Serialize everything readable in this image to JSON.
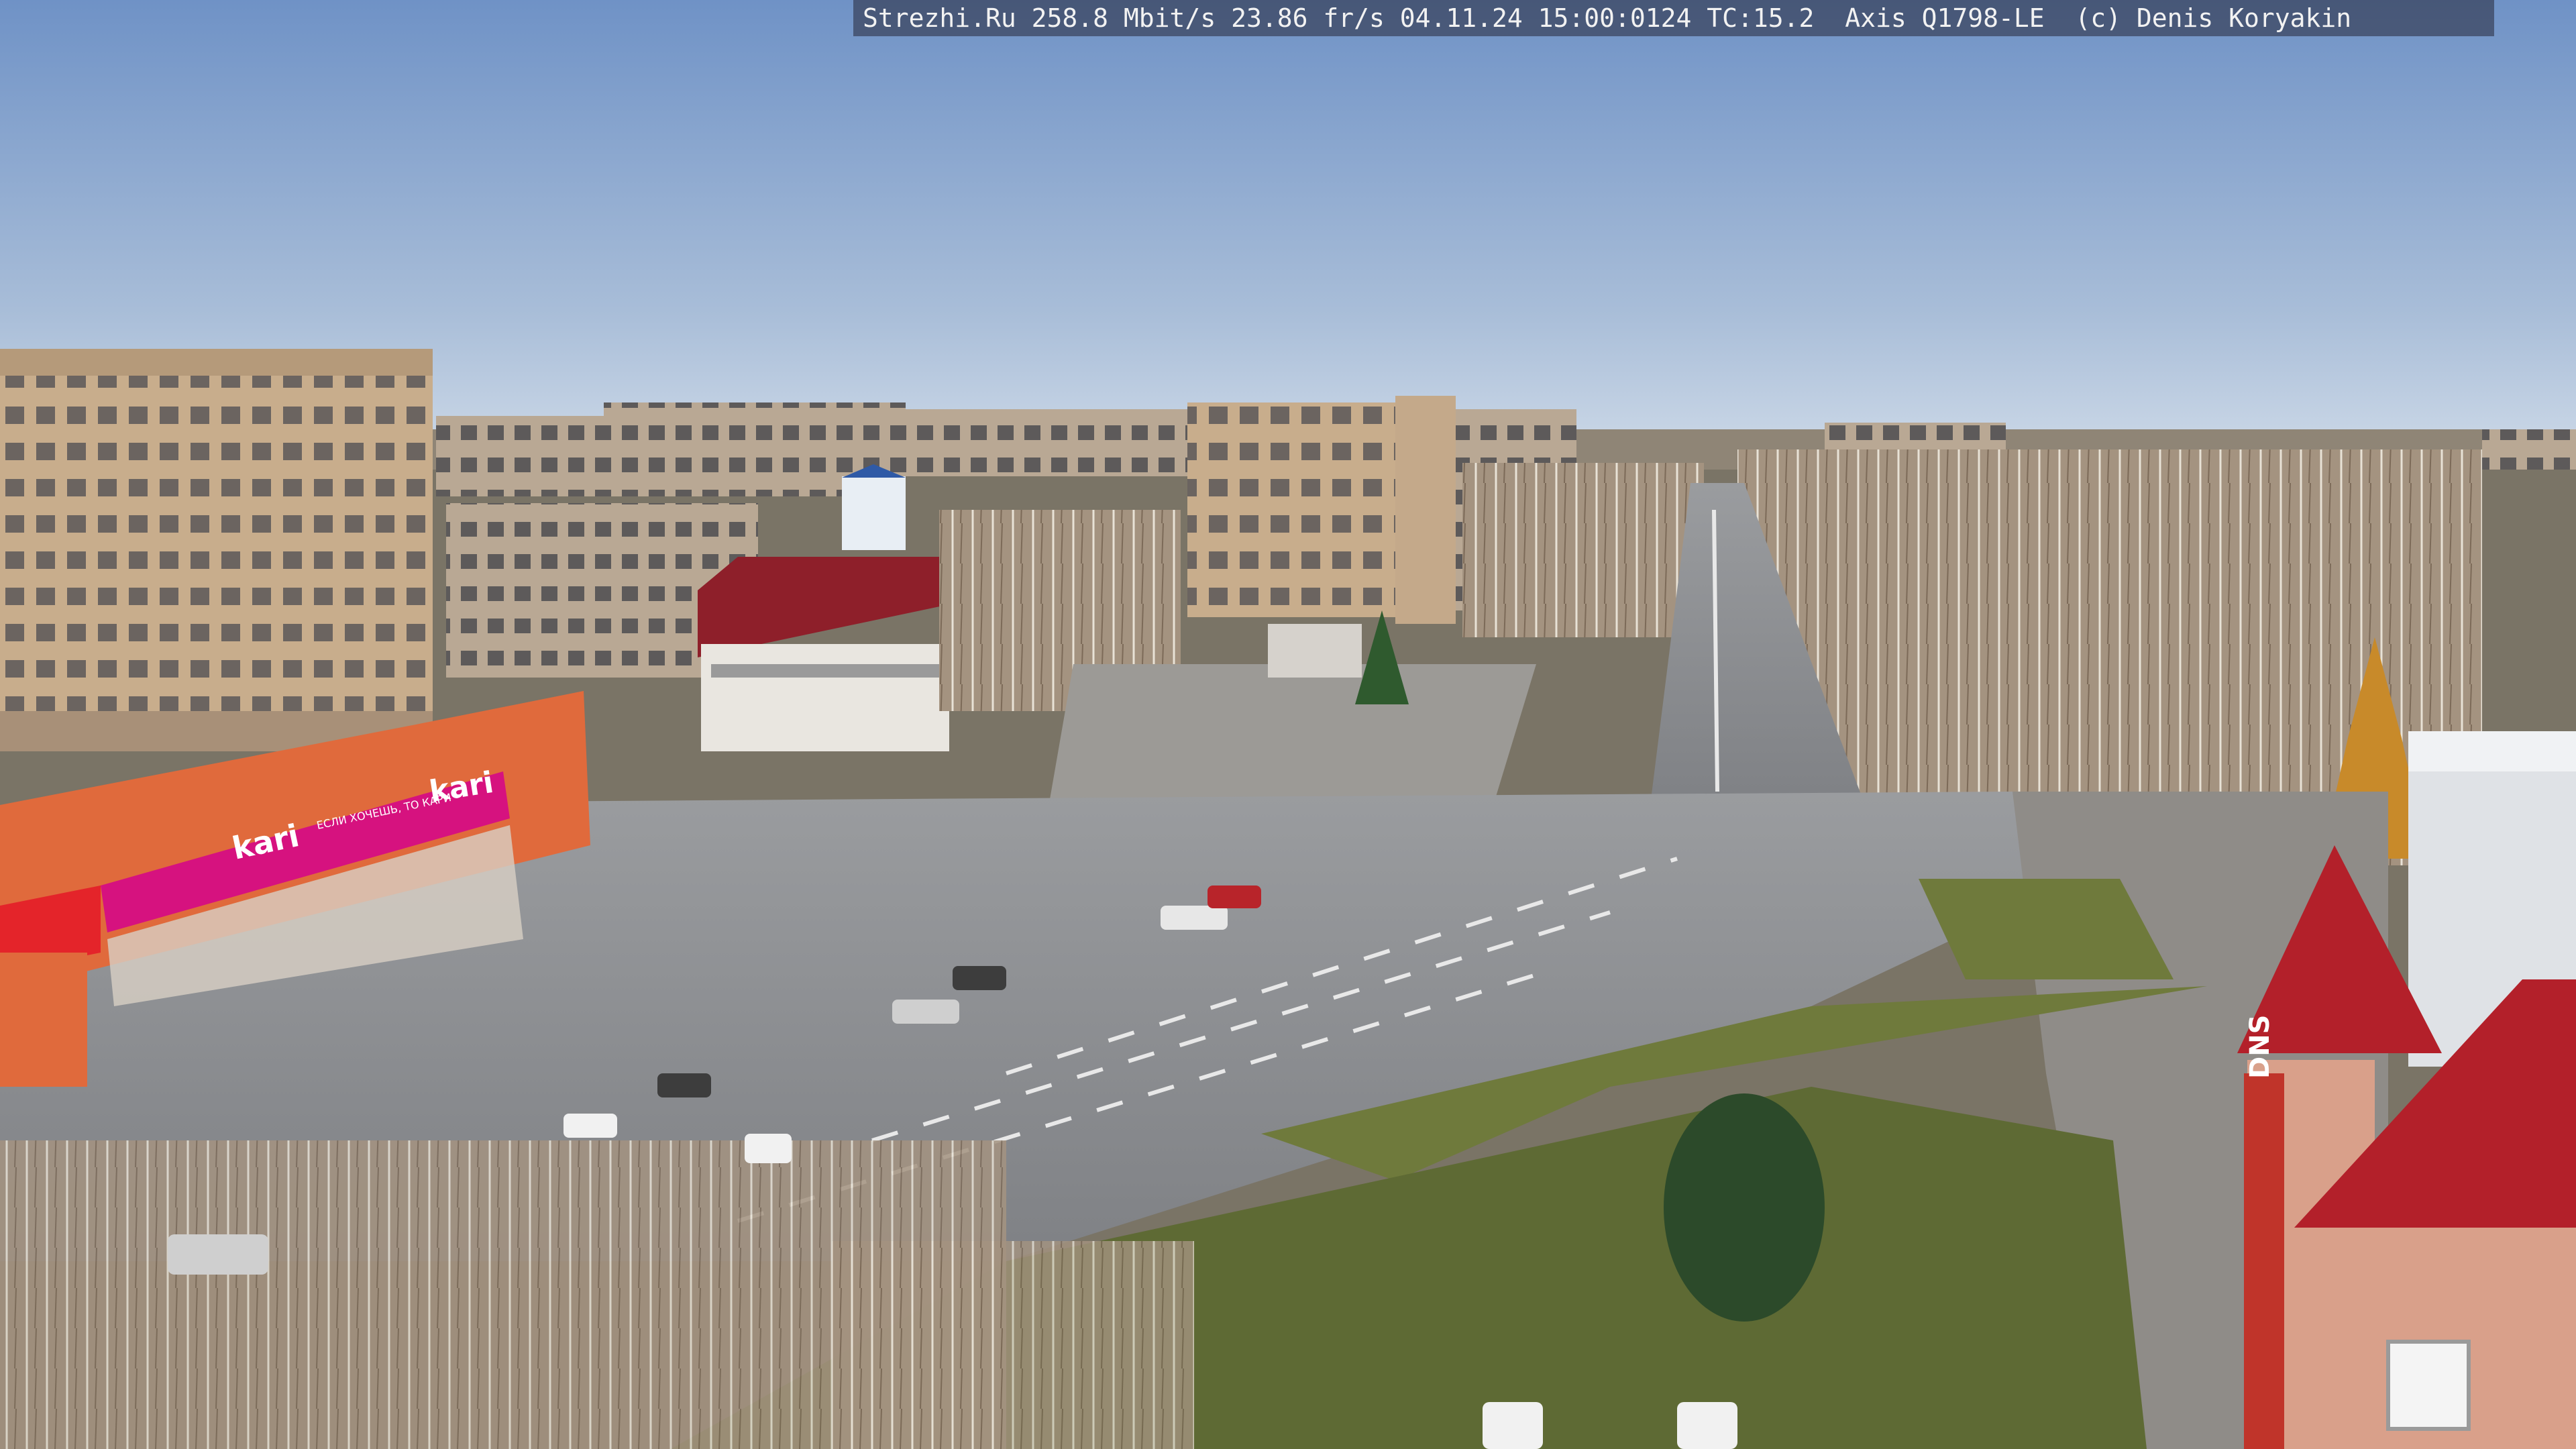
{
  "camera_overlay": {
    "text": "Strezhi.Ru 258.8 Mbit/s 23.86 fr/s 04.11.24 15:00:0124 TC:15.2  Axis Q1798-LE  (c) Denis Koryakin"
  },
  "signs": {
    "kari_upper": "kari",
    "kari_lower": "kari",
    "kari_tagline": "ЕСЛИ ХОЧЕШЬ, ТО КАРИ",
    "dns": "DNS"
  },
  "colors": {
    "sky_top": "#6f92c6",
    "sky_horizon": "#c9d6e6",
    "road": "#8d8f93",
    "grass": "#6f7a3c",
    "kari_magenta": "#d6127f",
    "shop_orange": "#e06a3c",
    "roof_red": "#b3202a",
    "panel_building": "#c8ad8c"
  }
}
